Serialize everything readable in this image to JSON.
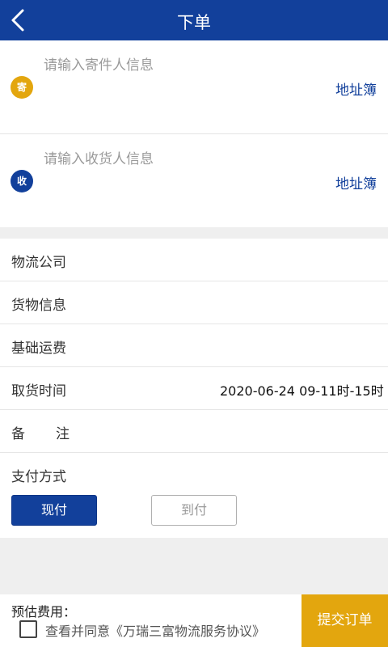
{
  "header": {
    "title": "下单",
    "back_icon": "chevron-left-icon"
  },
  "sender": {
    "placeholder": "请输入寄件人信息",
    "badge": "寄",
    "address_book": "地址簿",
    "badge_color": "#e3a60e"
  },
  "receiver": {
    "placeholder": "请输入收货人信息",
    "badge": "收",
    "address_book": "地址簿",
    "badge_color": "#12409b"
  },
  "form": {
    "rows": [
      {
        "label": "物流公司",
        "value": ""
      },
      {
        "label": "货物信息",
        "value": ""
      },
      {
        "label": "基础运费",
        "value": ""
      },
      {
        "label": "取货时间",
        "value": "2020-06-24 09-11时-15时"
      },
      {
        "label": "备注",
        "value": ""
      }
    ],
    "payment": {
      "label": "支付方式",
      "options": [
        "现付",
        "到付"
      ],
      "selected": "现付"
    }
  },
  "footer": {
    "estimate_label": "预估费用：",
    "agreement": "查看并同意《万瑞三富物流服务协议》",
    "submit": "提交订单"
  },
  "colors": {
    "primary": "#12409b",
    "accent": "#e3a60e"
  }
}
